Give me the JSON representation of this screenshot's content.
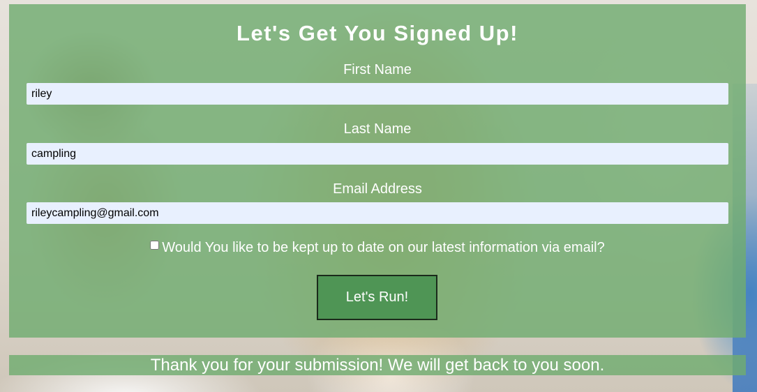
{
  "form": {
    "title": "Let's Get You Signed Up!",
    "first_name": {
      "label": "First Name",
      "value": "riley"
    },
    "last_name": {
      "label": "Last Name",
      "value": "campling"
    },
    "email": {
      "label": "Email Address",
      "value": "rileycampling@gmail.com"
    },
    "newsletter": {
      "label": "Would You like to be kept up to date on our latest information via email?",
      "checked": false
    },
    "submit_label": "Let's Run!"
  },
  "confirmation": {
    "message": "Thank you for your submission! We will get back to you soon."
  },
  "colors": {
    "panel_green": "#70ac70",
    "button_green": "#4f9555",
    "input_background": "#e8f0fe",
    "text": "#ffffff"
  }
}
